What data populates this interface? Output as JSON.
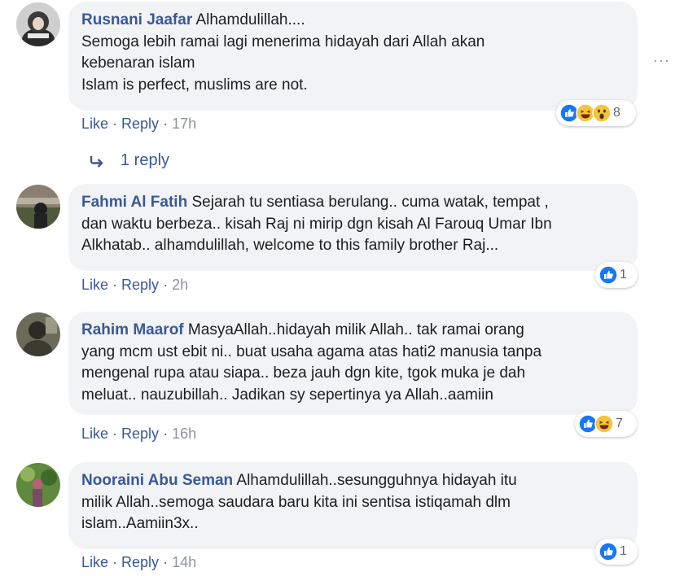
{
  "more_options": "···",
  "comments": [
    {
      "author": "Rusnani Jaafar",
      "lines": [
        "Alhamdulillah....",
        "Semoga lebih ramai lagi menerima hidayah dari Allah akan",
        "kebenaran islam",
        "Islam is perfect, muslims are not."
      ],
      "like": "Like",
      "reply": "Reply",
      "sep": "·",
      "time": "17h",
      "reaction_count": "8",
      "reactions": [
        "like-icon",
        "haha-icon",
        "wow-icon"
      ]
    },
    {
      "author": "Fahmi Al Fatih",
      "lines": [
        "Sejarah tu sentiasa berulang.. cuma watak, tempat ,",
        "dan waktu berbeza.. kisah Raj ni mirip dgn kisah Al Farouq Umar Ibn",
        "Alkhatab.. alhamdulillah, welcome to this family brother Raj..."
      ],
      "like": "Like",
      "reply": "Reply",
      "sep": "·",
      "time": "2h",
      "reaction_count": "1",
      "reactions": [
        "like-icon"
      ]
    },
    {
      "author": "Rahim Maarof",
      "lines": [
        "MasyaAllah..hidayah milik Allah.. tak ramai orang",
        "yang mcm ust ebit ni.. buat usaha agama atas hati2 manusia tanpa",
        "mengenal rupa atau siapa.. beza jauh dgn kite, tgok muka je dah",
        "meluat.. nauzubillah.. Jadikan sy sepertinya ya Allah..aamiin"
      ],
      "like": "Like",
      "reply": "Reply",
      "sep": "·",
      "time": "16h",
      "reaction_count": "7",
      "reactions": [
        "like-icon",
        "haha-icon"
      ]
    },
    {
      "author": "Nooraini Abu Seman",
      "lines": [
        "Alhamdulillah..sesungguhnya hidayah itu",
        "milik Allah..semoga saudara baru kita ini sentisa istiqamah dlm",
        "islam..Aamiin3x.."
      ],
      "like": "Like",
      "reply": "Reply",
      "sep": "·",
      "time": "14h",
      "reaction_count": "1",
      "reactions": [
        "like-icon"
      ]
    }
  ],
  "reply_thread": {
    "label": "1 reply",
    "icon": "reply-arrow-icon"
  },
  "colors": {
    "link": "#385898",
    "bubble": "#f2f3f5",
    "meta": "#616770",
    "like_blue": "#1877f2",
    "haha_yellow": "#f7c33d"
  }
}
